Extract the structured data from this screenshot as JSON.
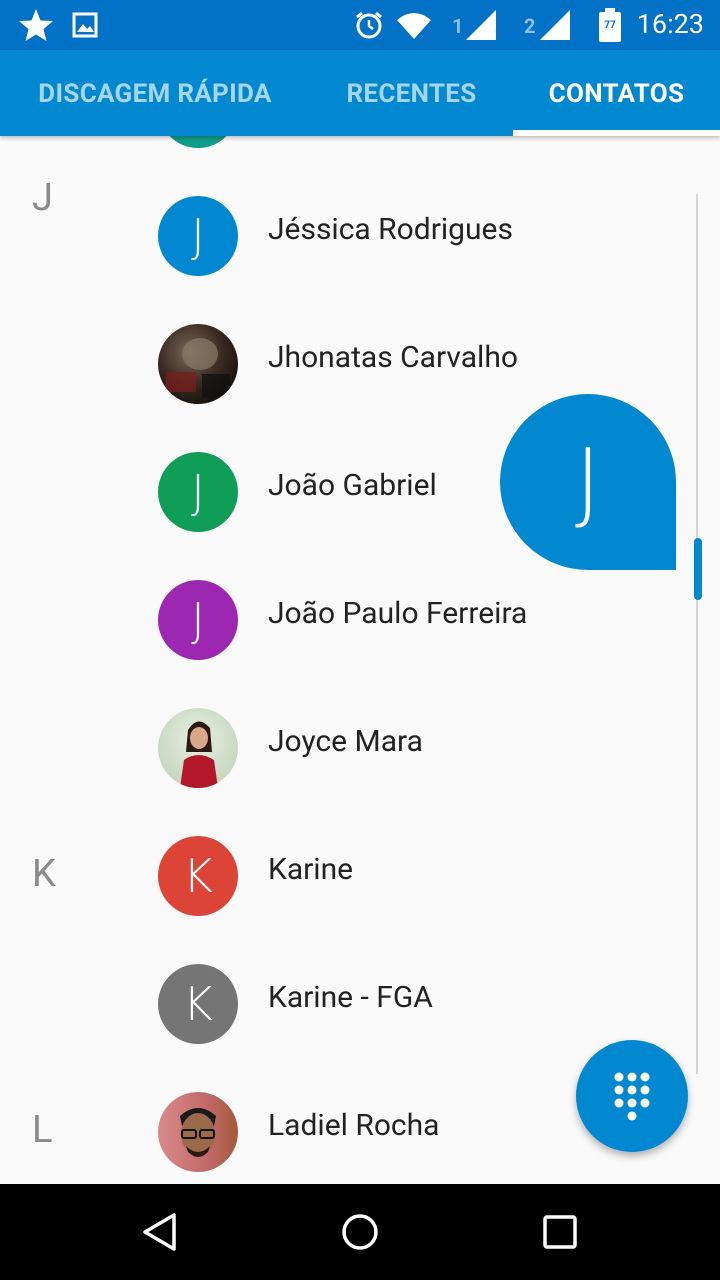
{
  "status_bar": {
    "time": "16:23",
    "sim1_label": "1",
    "sim2_label": "2",
    "battery_level": "77",
    "icons": [
      "star-icon",
      "image-icon",
      "alarm-icon",
      "wifi-icon",
      "signal-icon",
      "signal-icon",
      "battery-icon"
    ]
  },
  "tabs": [
    {
      "label": "DISCAGEM RÁPIDA",
      "active": false
    },
    {
      "label": "RECENTES",
      "active": false
    },
    {
      "label": "CONTATOS",
      "active": true
    }
  ],
  "sections": [
    {
      "letter": "J"
    },
    {
      "letter": "K"
    },
    {
      "letter": "L"
    }
  ],
  "contacts": [
    {
      "name": "Jéssica Rodrigues",
      "initial": "J",
      "color": "#0288d1",
      "photo": false
    },
    {
      "name": "Jhonatas Carvalho",
      "initial": "",
      "color": "#3a2a22",
      "photo": true
    },
    {
      "name": "João Gabriel",
      "initial": "J",
      "color": "#0f9d58",
      "photo": false
    },
    {
      "name": "João Paulo Ferreira",
      "initial": "J",
      "color": "#9c27b0",
      "photo": false
    },
    {
      "name": "Joyce Mara",
      "initial": "",
      "color": "#c8d8c0",
      "photo": true
    },
    {
      "name": "Karine",
      "initial": "K",
      "color": "#db4437",
      "photo": false
    },
    {
      "name": "Karine - FGA",
      "initial": "K",
      "color": "#757575",
      "photo": false
    },
    {
      "name": "Ladiel Rocha",
      "initial": "",
      "color": "#b86b6b",
      "photo": true
    }
  ],
  "fast_scroll": {
    "bubble_letter": "J"
  },
  "colors": {
    "status_bar": "#0172c6",
    "tab_bar": "#0288d1",
    "accent": "#0288d1"
  }
}
